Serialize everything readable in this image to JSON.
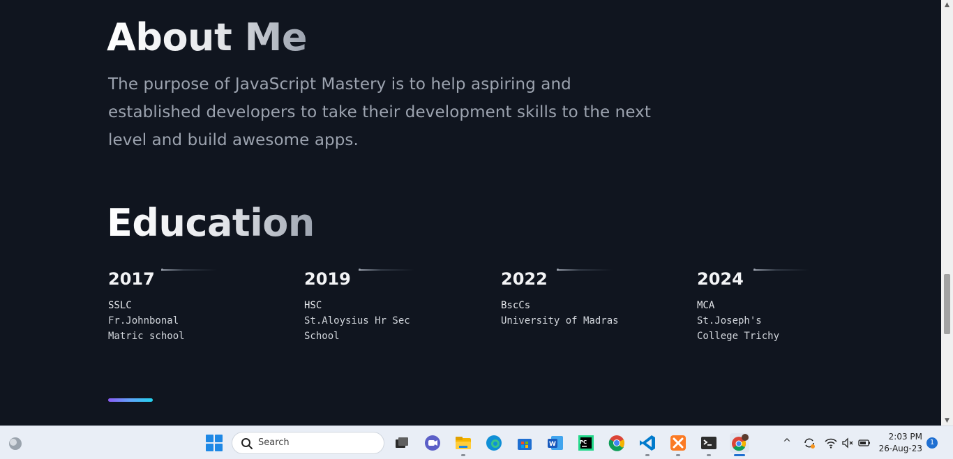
{
  "about": {
    "title": "About Me",
    "text": "The purpose of JavaScript Mastery is to help aspiring and established developers to take their development skills to the next level and build awesome apps."
  },
  "education": {
    "title": "Education",
    "items": [
      {
        "year": "2017",
        "degree": "SSLC",
        "school": "Fr.Johnbonal Matric school"
      },
      {
        "year": "2019",
        "degree": "HSC",
        "school": "St.Aloysius Hr Sec School"
      },
      {
        "year": "2022",
        "degree": "BscCs",
        "school": "University of Madras"
      },
      {
        "year": "2024",
        "degree": "MCA",
        "school": "St.Joseph's College Trichy"
      }
    ]
  },
  "accent_colors": [
    "#8b5cf6",
    "#60a5fa",
    "#22d3ee"
  ],
  "taskbar": {
    "search_label": "Search",
    "apps": [
      "task-view",
      "teams-chat",
      "file-explorer",
      "edge",
      "microsoft-store",
      "word",
      "pycharm",
      "chrome",
      "vscode",
      "xampp",
      "terminal",
      "chrome-profile"
    ],
    "clock": {
      "time": "2:03 PM",
      "date": "26-Aug-23"
    },
    "notifications": "1"
  }
}
